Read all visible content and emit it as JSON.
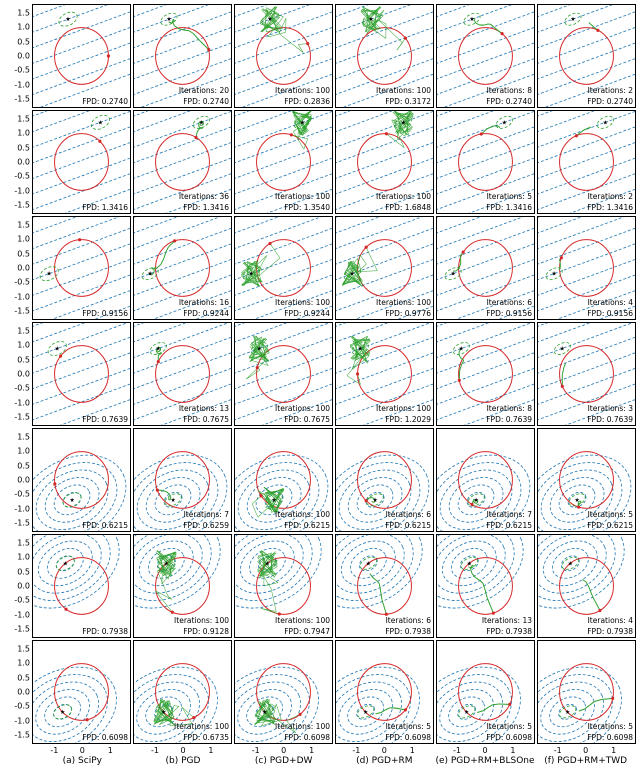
{
  "chart_data": {
    "type": "small-multiples",
    "rows": 7,
    "cols": 6,
    "xlim": [
      -1.8,
      1.8
    ],
    "ylim": [
      -1.8,
      1.8
    ],
    "xticks": [
      -1,
      0,
      1
    ],
    "yticks": [
      -1.5,
      -1.0,
      -0.5,
      0.0,
      0.5,
      1.0,
      1.5
    ],
    "column_labels": [
      "(a) SciPy",
      "(b) PGD",
      "(c) PGD+DW",
      "(d) PGD+RM",
      "(e) PGD+RM+BLSOne",
      "(f) PGD+RM+TWD"
    ],
    "circle": {
      "cx": 0,
      "cy": 0,
      "r": 1,
      "stroke": "#d62728"
    },
    "field_contours": {
      "note": "Dashed blue level sets of quadratic cost; dashed green = active set / iterate path"
    },
    "series": [
      {
        "row": 0,
        "problem_center": [
          -0.5,
          1.3
        ],
        "fpd_scipy": 0.274,
        "cells": [
          {
            "col": 0,
            "fpd": 0.274,
            "iterations": null
          },
          {
            "col": 1,
            "fpd": 0.274,
            "iterations": 20
          },
          {
            "col": 2,
            "fpd": 0.2836,
            "iterations": 100
          },
          {
            "col": 3,
            "fpd": 0.3172,
            "iterations": 100
          },
          {
            "col": 4,
            "fpd": 0.274,
            "iterations": 8
          },
          {
            "col": 5,
            "fpd": 0.274,
            "iterations": 2
          }
        ]
      },
      {
        "row": 1,
        "problem_center": [
          0.7,
          1.4
        ],
        "fpd_scipy": 1.3416,
        "cells": [
          {
            "col": 0,
            "fpd": 1.3416,
            "iterations": null
          },
          {
            "col": 1,
            "fpd": 1.3416,
            "iterations": 36
          },
          {
            "col": 2,
            "fpd": 1.354,
            "iterations": 100
          },
          {
            "col": 3,
            "fpd": 1.6848,
            "iterations": 100
          },
          {
            "col": 4,
            "fpd": 1.3416,
            "iterations": 5
          },
          {
            "col": 5,
            "fpd": 1.3416,
            "iterations": 2
          }
        ]
      },
      {
        "row": 2,
        "problem_center": [
          -1.2,
          -0.2
        ],
        "fpd_scipy": 0.9156,
        "cells": [
          {
            "col": 0,
            "fpd": 0.9156,
            "iterations": null
          },
          {
            "col": 1,
            "fpd": 0.9244,
            "iterations": 16
          },
          {
            "col": 2,
            "fpd": 0.9244,
            "iterations": 100
          },
          {
            "col": 3,
            "fpd": 0.9776,
            "iterations": 100
          },
          {
            "col": 4,
            "fpd": 0.9156,
            "iterations": 6
          },
          {
            "col": 5,
            "fpd": 0.9156,
            "iterations": 4
          }
        ]
      },
      {
        "row": 3,
        "problem_center": [
          -0.9,
          0.9
        ],
        "fpd_scipy": 0.7639,
        "cells": [
          {
            "col": 0,
            "fpd": 0.7639,
            "iterations": null
          },
          {
            "col": 1,
            "fpd": 0.7675,
            "iterations": 13
          },
          {
            "col": 2,
            "fpd": 0.7675,
            "iterations": 100
          },
          {
            "col": 3,
            "fpd": 1.2029,
            "iterations": 100
          },
          {
            "col": 4,
            "fpd": 0.7639,
            "iterations": 8
          },
          {
            "col": 5,
            "fpd": 0.7639,
            "iterations": 3
          }
        ]
      },
      {
        "row": 4,
        "problem_center": [
          -0.35,
          -0.7
        ],
        "fpd_scipy": 0.6215,
        "cells": [
          {
            "col": 0,
            "fpd": 0.6215,
            "iterations": null
          },
          {
            "col": 1,
            "fpd": 0.6259,
            "iterations": 7
          },
          {
            "col": 2,
            "fpd": 0.6215,
            "iterations": 100
          },
          {
            "col": 3,
            "fpd": 0.6215,
            "iterations": 6
          },
          {
            "col": 4,
            "fpd": 0.6215,
            "iterations": 7
          },
          {
            "col": 5,
            "fpd": 0.6215,
            "iterations": 5
          }
        ]
      },
      {
        "row": 5,
        "problem_center": [
          -0.6,
          0.8
        ],
        "fpd_scipy": 0.7938,
        "cells": [
          {
            "col": 0,
            "fpd": 0.7938,
            "iterations": null
          },
          {
            "col": 1,
            "fpd": 0.9128,
            "iterations": 100
          },
          {
            "col": 2,
            "fpd": 0.7947,
            "iterations": 100
          },
          {
            "col": 3,
            "fpd": 0.7938,
            "iterations": 6
          },
          {
            "col": 4,
            "fpd": 0.7938,
            "iterations": 13
          },
          {
            "col": 5,
            "fpd": 0.7938,
            "iterations": 4
          }
        ]
      },
      {
        "row": 6,
        "problem_center": [
          -0.7,
          -0.7
        ],
        "fpd_scipy": 0.6098,
        "cells": [
          {
            "col": 0,
            "fpd": 0.6098,
            "iterations": null
          },
          {
            "col": 1,
            "fpd": 0.6735,
            "iterations": 100
          },
          {
            "col": 2,
            "fpd": 0.6098,
            "iterations": 100
          },
          {
            "col": 3,
            "fpd": 0.6098,
            "iterations": 5
          },
          {
            "col": 4,
            "fpd": 0.6098,
            "iterations": 5
          },
          {
            "col": 5,
            "fpd": 0.6098,
            "iterations": 5
          }
        ]
      }
    ]
  },
  "labels": {
    "iter_prefix": "Iterations: ",
    "fpd_prefix": "FPD: "
  },
  "colors": {
    "circle": "#d62728",
    "contours": "#1f77b4",
    "path": "#2ca02c",
    "star": "#000000",
    "marker": "#d62728"
  }
}
